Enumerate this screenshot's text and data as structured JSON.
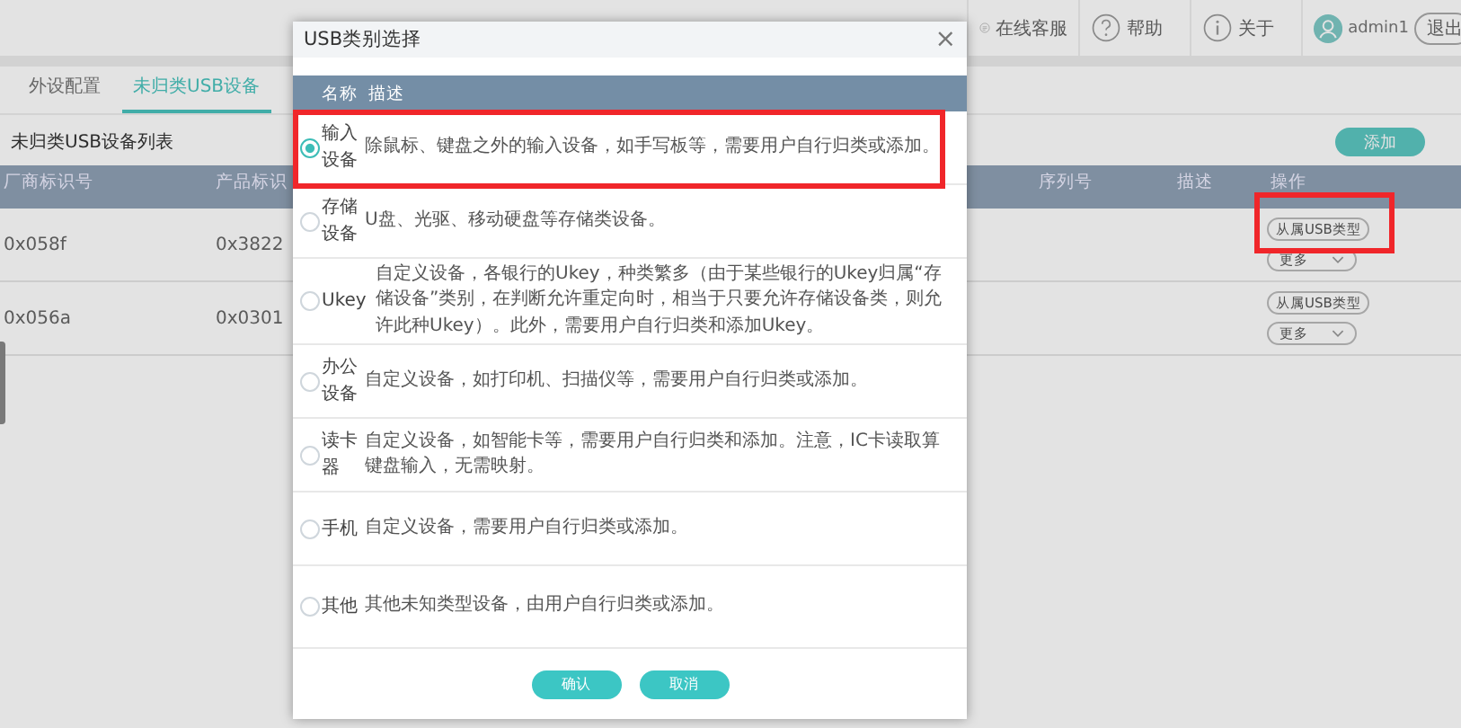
{
  "header": {
    "items": [
      {
        "kind": "service",
        "label": "在线客服"
      },
      {
        "kind": "help",
        "label": "帮助"
      },
      {
        "kind": "about",
        "label": "关于"
      }
    ],
    "user": "admin1",
    "logout": "退出"
  },
  "tabs": [
    {
      "label": "外设配置",
      "selected": false
    },
    {
      "label": "未归类USB设备",
      "selected": true
    }
  ],
  "section_title": "未归类USB设备列表",
  "add_button": "添加",
  "table": {
    "columns": [
      "厂商标识号",
      "产品标识",
      "序列号",
      "描述",
      "操作"
    ],
    "rows": [
      {
        "vendor": "0x058f",
        "product": "0x3822",
        "assign": "从属USB类型",
        "more": "更多"
      },
      {
        "vendor": "0x056a",
        "product": "0x0301",
        "assign": "从属USB类型",
        "more": "更多"
      }
    ]
  },
  "dialog": {
    "title": "USB类别选择",
    "close": "×",
    "columns": [
      "名称",
      "描述"
    ],
    "options": [
      {
        "name": "输入设备",
        "description": "除鼠标、键盘之外的输入设备，如手写板等，需要用户自行归类或添加。",
        "selected": true
      },
      {
        "name": "存储设备",
        "description": "U盘、光驱、移动硬盘等存储类设备。",
        "selected": false
      },
      {
        "name": "Ukey",
        "description": "自定义设备，各银行的Ukey，种类繁多（由于某些银行的Ukey归属“存储设备”类别，在判断允许重定向时，相当于只要允许存储设备类，则允许此种Ukey）。此外，需要用户自行归类和添加Ukey。",
        "selected": false
      },
      {
        "name": "办公设备",
        "description": "自定义设备，如打印机、扫描仪等，需要用户自行归类或添加。",
        "selected": false
      },
      {
        "name": "读卡器",
        "description": "自定义设备，如智能卡等，需要用户自行归类和添加。注意，IC卡读取算键盘输入，无需映射。",
        "selected": false
      },
      {
        "name": "手机",
        "description": "自定义设备，需要用户自行归类或添加。",
        "selected": false
      },
      {
        "name": "其他",
        "description": "其他未知类型设备，由用户自行归类或添加。",
        "selected": false
      }
    ],
    "buttons": [
      "确认",
      "取消"
    ]
  }
}
